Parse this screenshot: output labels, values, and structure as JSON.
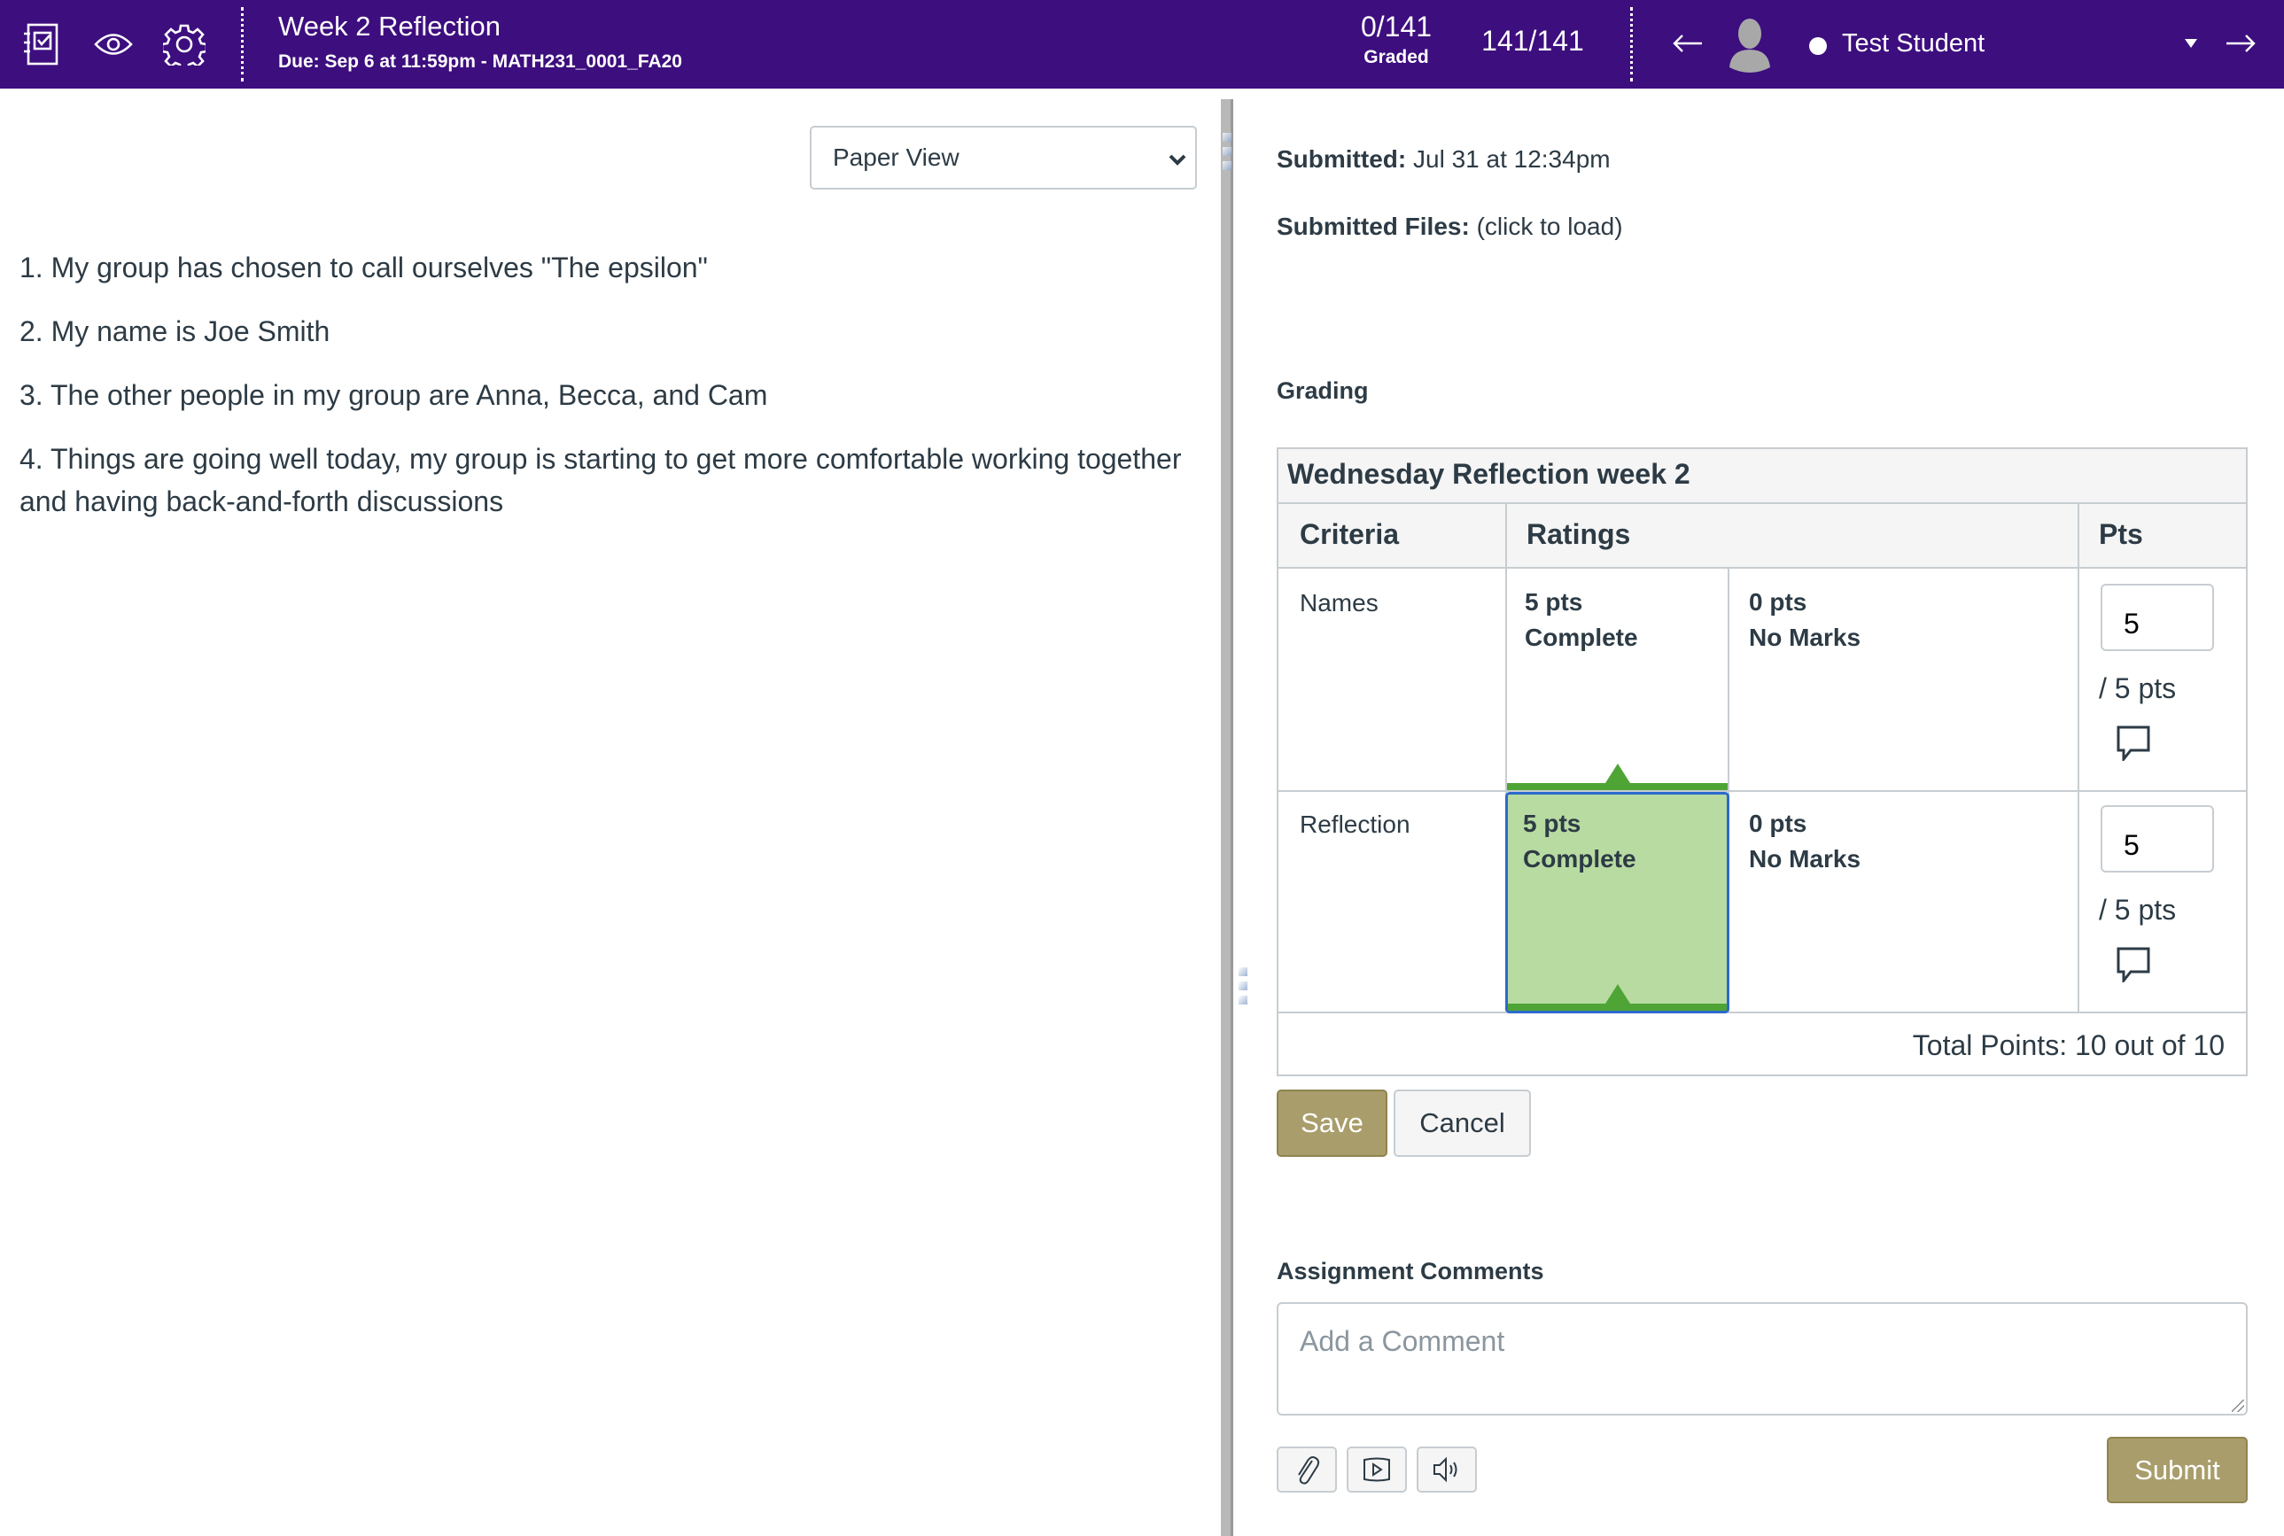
{
  "header": {
    "icons": [
      "gradebook-icon",
      "eye-icon",
      "settings-gear-icon"
    ],
    "assignment_title": "Week 2 Reflection",
    "assignment_subtitle": "Due: Sep 6 at 11:59pm - MATH231_0001_FA20",
    "graded_count": "0/141",
    "graded_label": "Graded",
    "submitted_count": "141/141",
    "student_name": "Test Student",
    "colors": {
      "bar": "#3D0E7E"
    }
  },
  "left_pane": {
    "view_select": {
      "selected": "Paper View"
    },
    "submission_text": [
      "1. My group has chosen to call ourselves \"The epsilon\"",
      "2. My name is Joe Smith",
      "3. The other people in my group are Anna, Becca, and Cam",
      "4. Things are going well today, my group is starting to get more comfortable working together and having back-and-forth discussions"
    ]
  },
  "right_pane": {
    "submitted_label": "Submitted:",
    "submitted_value": "Jul 31 at 12:34pm",
    "files_label": "Submitted Files:",
    "files_value": "(click to load)",
    "grading_label": "Grading",
    "rubric": {
      "title": "Wednesday Reflection week 2",
      "columns": {
        "criteria": "Criteria",
        "ratings": "Ratings",
        "pts": "Pts"
      },
      "rows": [
        {
          "criterion": "Names",
          "ratings": [
            {
              "points": "5 pts",
              "label": "Complete",
              "selected": false,
              "marked": true
            },
            {
              "points": "0 pts",
              "label": "No Marks",
              "selected": false,
              "marked": false
            }
          ],
          "score": "5",
          "out_of": "/ 5 pts"
        },
        {
          "criterion": "Reflection",
          "ratings": [
            {
              "points": "5 pts",
              "label": "Complete",
              "selected": true,
              "marked": true
            },
            {
              "points": "0 pts",
              "label": "No Marks",
              "selected": false,
              "marked": false
            }
          ],
          "score": "5",
          "out_of": "/ 5 pts"
        }
      ],
      "total": "Total Points: 10 out of 10"
    },
    "save_label": "Save",
    "cancel_label": "Cancel",
    "comments_label": "Assignment Comments",
    "comment_placeholder": "Add a Comment",
    "comment_value": "",
    "comment_tools": [
      "attach-file-icon",
      "media-video-icon",
      "audio-speaker-icon"
    ],
    "submit_label": "Submit",
    "colors": {
      "primary_button": "#A99D6B",
      "selected_rating": "#B8DBA2",
      "rating_marker": "#4FA436",
      "focus_border": "#2B6ACE"
    }
  }
}
